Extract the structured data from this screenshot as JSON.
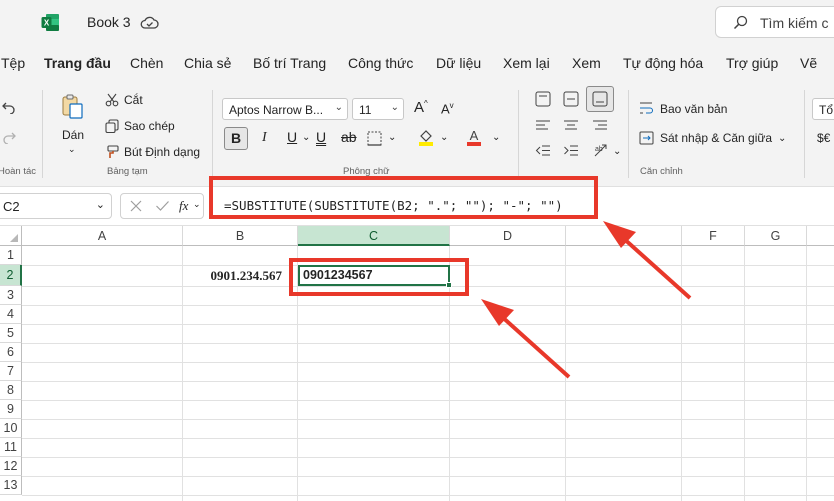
{
  "titlebar": {
    "book_title": "Book 3",
    "search_placeholder": "Tìm kiếm c",
    "logo_letter": "X"
  },
  "menu": {
    "tabs": [
      {
        "label": "Tệp"
      },
      {
        "label": "Trang đầu",
        "active": true
      },
      {
        "label": "Chèn"
      },
      {
        "label": "Chia sẻ"
      },
      {
        "label": "Bố trí Trang"
      },
      {
        "label": "Công thức"
      },
      {
        "label": "Dữ liệu"
      },
      {
        "label": "Xem lại"
      },
      {
        "label": "Xem"
      },
      {
        "label": "Tự động hóa"
      },
      {
        "label": "Trợ giúp"
      },
      {
        "label": "Vẽ"
      }
    ]
  },
  "ribbon": {
    "undo_group_label": "Hoàn tác",
    "paste_label": "Dán",
    "cut_label": "Cắt",
    "copy_label": "Sao chép",
    "format_painter_label": "Bút Định dạng",
    "clipboard_group_label": "Bảng tạm",
    "font_name": "Aptos Narrow B...",
    "font_size": "11",
    "bold_label": "B",
    "font_group_label": "Phông chữ",
    "wrap_text_label": "Bao văn bản",
    "merge_center_label": "Sát nhập & Căn giữa",
    "alignment_group_label": "Căn chỉnh",
    "number_format_partial": "Tổ",
    "currency_partial": "$€"
  },
  "formula_bar": {
    "name_box": "C2",
    "formula": "=SUBSTITUTE(SUBSTITUTE(B2; \".\"; \"\"); \"-\"; \"\")",
    "fx_label": "fx"
  },
  "grid": {
    "columns": [
      "A",
      "B",
      "C",
      "D",
      "E",
      "F",
      "G"
    ],
    "rows": [
      "1",
      "2",
      "3",
      "4",
      "5",
      "6",
      "7",
      "8",
      "9",
      "10",
      "11",
      "12",
      "13"
    ],
    "selected_cell": "C2",
    "cells": {
      "B2": "0901.234.567",
      "C2": "0901234567"
    }
  },
  "colors": {
    "accent_green": "#217346",
    "annotation_red": "#e8382a",
    "header_selected_bg": "#c7e5d2"
  }
}
